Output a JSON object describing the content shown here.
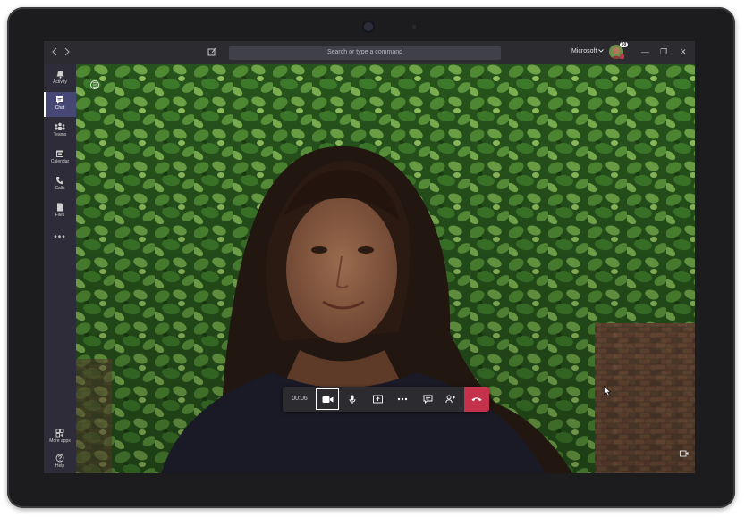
{
  "titlebar": {
    "back_icon": "chevron-left-icon",
    "forward_icon": "chevron-right-icon",
    "search_placeholder": "Search or type a command",
    "org_name": "Microsoft",
    "org_dropdown_icon": "chevron-down-icon",
    "avatar_badge": "60",
    "minimize": "—",
    "maximize": "❐",
    "close": "✕"
  },
  "rail": {
    "items": [
      {
        "label": "Activity",
        "icon": "bell-icon",
        "active": false
      },
      {
        "label": "Chat",
        "icon": "chat-icon",
        "active": true
      },
      {
        "label": "Teams",
        "icon": "teams-icon",
        "active": false
      },
      {
        "label": "Calendar",
        "icon": "calendar-icon",
        "active": false
      },
      {
        "label": "Calls",
        "icon": "phone-icon",
        "active": false
      },
      {
        "label": "Files",
        "icon": "file-icon",
        "active": false
      }
    ],
    "more": "•••",
    "bottom": [
      {
        "label": "More apps",
        "icon": "apps-icon"
      },
      {
        "label": "Help",
        "icon": "help-icon"
      }
    ]
  },
  "call": {
    "timer": "00:06",
    "controls": [
      "video-camera-icon",
      "microphone-icon",
      "share-screen-icon",
      "more-options-icon",
      "chat-bubble-icon",
      "participants-icon",
      "hang-up-icon"
    ],
    "hangup_color": "#c4314b"
  },
  "colors": {
    "rail_bg": "#2d2c38",
    "active_rail": "#464775",
    "titlebar_bg": "#2b2b30"
  }
}
